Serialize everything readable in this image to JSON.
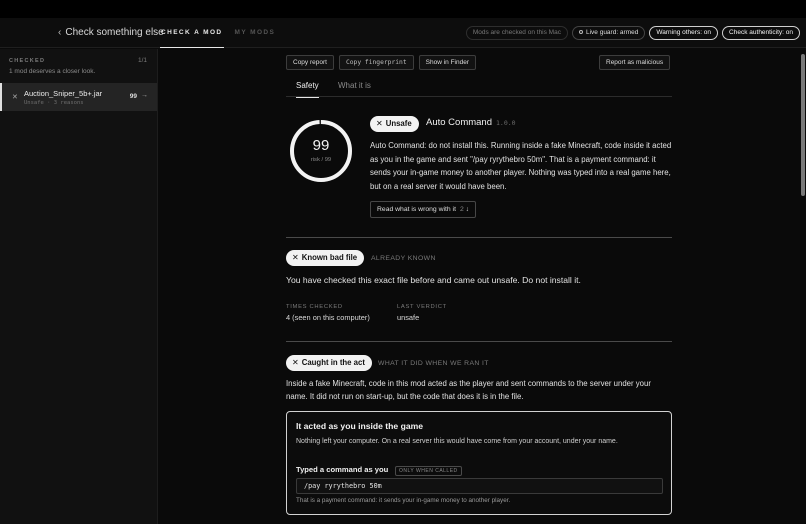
{
  "header": {
    "back_label": "Check something else",
    "tabs": [
      {
        "label": "CHECK A MOD",
        "active": true
      },
      {
        "label": "MY MODS",
        "active": false
      }
    ],
    "status_pills": [
      {
        "label": "Mods are checked on this Mac",
        "style": "muted"
      },
      {
        "label": "Live guard: armed",
        "style": "normal",
        "icon": "dot-icon"
      },
      {
        "label": "Warning others: on",
        "style": "bright"
      },
      {
        "label": "Check authenticity: on",
        "style": "bright"
      }
    ]
  },
  "sidebar": {
    "heading": "CHECKED",
    "count": "1/1",
    "subtitle": "1 mod deserves a closer look.",
    "files": [
      {
        "name": "Auction_Sniper_5b+.jar",
        "meta": "Unsafe · 3 reasons",
        "score": "99",
        "status_icon": "x-icon"
      }
    ]
  },
  "toolbar": {
    "copy_report": "Copy report",
    "copy_fingerprint": "Copy fingerprint",
    "show_in_finder": "Show in Finder",
    "report_malicious": "Report as malicious"
  },
  "content_tabs": [
    {
      "label": "Safety",
      "active": true
    },
    {
      "label": "What it is",
      "active": false
    }
  ],
  "verdict": {
    "score": "99",
    "score_sub": "risk / 99",
    "risk_fraction": 0.99,
    "badge": "Unsafe",
    "mod_name": "Auto Command",
    "version": "1.0.0",
    "description": "Auto Command: do not install this. Running inside a fake Minecraft, code inside it acted as you in the game and sent \"/pay ryrythebro 50m\". That is a payment command: it sends your in-game money to another player. Nothing was typed into a real game here, but on a real server it would have been.",
    "read_more": "Read what is wrong with it",
    "read_more_count": "2",
    "read_more_icon": "arrow-down-icon"
  },
  "known_bad": {
    "badge": "Known bad file",
    "tag": "ALREADY KNOWN",
    "text": "You have checked this exact file before and came out unsafe. Do not install it.",
    "times_label": "TIMES CHECKED",
    "times_value": "4 (seen on this computer)",
    "verdict_label": "LAST VERDICT",
    "verdict_value": "unsafe"
  },
  "caught": {
    "badge": "Caught in the act",
    "tag": "WHAT IT DID WHEN WE RAN IT",
    "text": "Inside a fake Minecraft, code in this mod acted as the player and sent commands to the server under your name. It did not run on start-up, but the code that does it is in the file.",
    "card": {
      "title": "It acted as you inside the game",
      "desc": "Nothing left your computer. On a real server this would have come from your account, under your name.",
      "typed_label": "Typed a command as you",
      "typed_tag": "ONLY WHEN CALLED",
      "command": "/pay ryrythebro 50m",
      "note": "That is a payment command: it sends your in-game money to another player."
    }
  },
  "colors": {
    "background": "#0a0a0a",
    "sidebar": "#111111",
    "selected_row": "#242424",
    "badge_bg": "#f2f2f2",
    "text": "#e9e9e9"
  }
}
